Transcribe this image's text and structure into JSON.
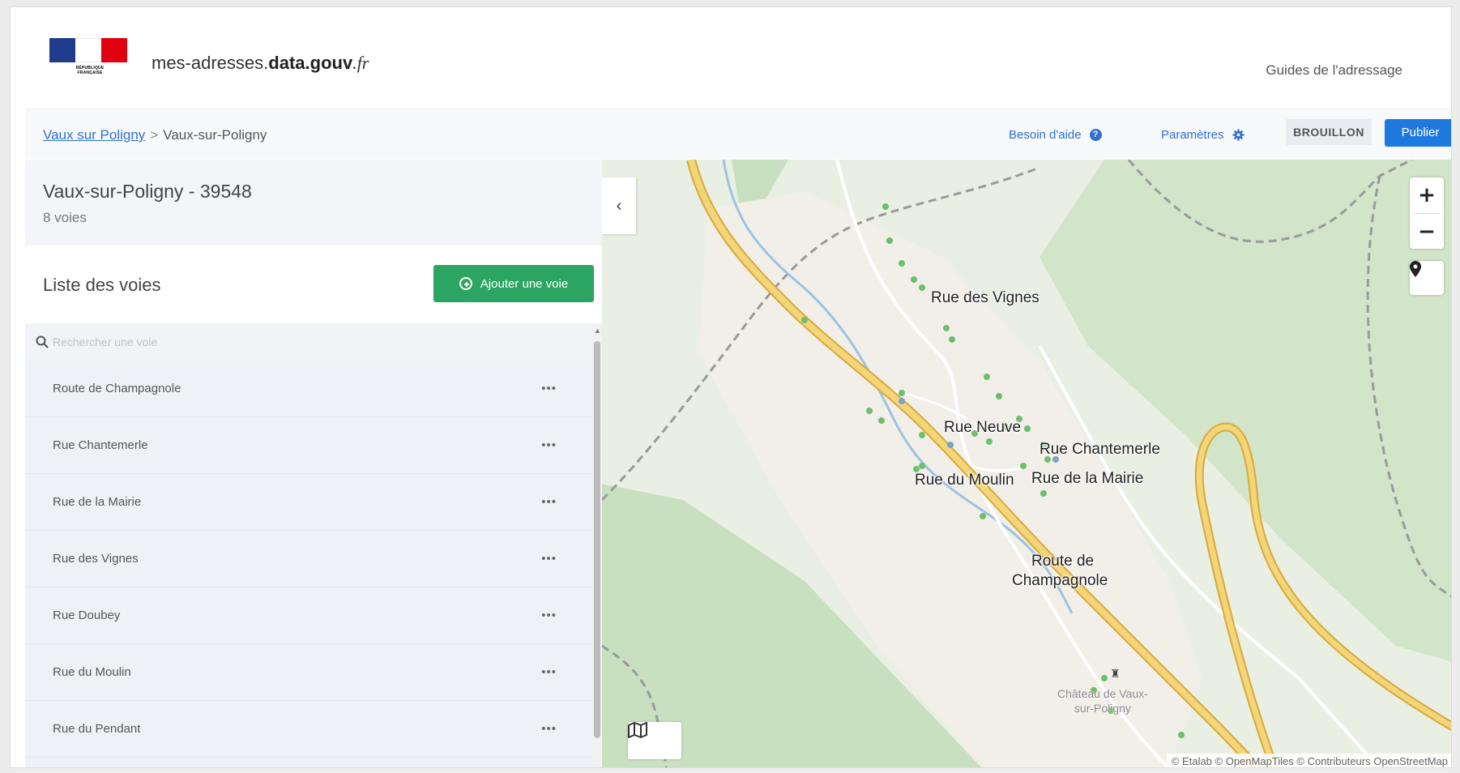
{
  "header": {
    "logo_text": "Liberté · Égalité · Fraternité\nRÉPUBLIQUE FRANÇAISE",
    "site_prefix": "mes-adresses.",
    "site_bold": "data.gouv",
    "site_suffix": ".fr",
    "guides_label": "Guides de l'adressage"
  },
  "toolbar": {
    "breadcrumb_link": "Vaux sur Poligny",
    "breadcrumb_sep": ">",
    "breadcrumb_current": "Vaux-sur-Poligny",
    "help_label": "Besoin d'aide",
    "settings_label": "Paramètres",
    "status_badge": "BROUILLON",
    "publish_label": "Publier"
  },
  "sidebar": {
    "commune_name": "Vaux-sur-Poligny - 39548",
    "voies_count": "8 voies",
    "list_title": "Liste des voies",
    "add_label": "Ajouter une voie",
    "search_placeholder": "Rechercher une voie",
    "voies": [
      {
        "name": "Route de Champagnole"
      },
      {
        "name": "Rue Chantemerle"
      },
      {
        "name": "Rue de la Mairie"
      },
      {
        "name": "Rue des Vignes"
      },
      {
        "name": "Rue Doubey"
      },
      {
        "name": "Rue du Moulin"
      },
      {
        "name": "Rue du Pendant"
      }
    ],
    "more_glyph": "•••"
  },
  "map": {
    "collapse_glyph": "‹",
    "zoom_in": "+",
    "zoom_out": "−",
    "labels": {
      "rue_des_vignes": "Rue des Vignes",
      "rue_neuve": "Rue Neuve",
      "rue_chantemerle": "Rue Chantemerle",
      "rue_du_moulin": "Rue du Moulin",
      "rue_de_la_mairie": "Rue de la Mairie",
      "route_line1": "Route de",
      "route_line2": "Champagnole",
      "chateau_line1": "Château de Vaux-",
      "chateau_line2": "sur-Poligny"
    },
    "poi_glyph": "♜",
    "attribution": "© Etalab © OpenMapTiles © Contributeurs OpenStreetMap",
    "colors": {
      "background": "#e9efe3",
      "forest": "#c9e0c0",
      "village": "#f2efe9",
      "main_road": "#f3d57a",
      "road_edge": "#d9a93a",
      "boundary": "#9a9a9a",
      "river": "#9cc3e0",
      "address_dot": "#6cbf6c"
    }
  },
  "colors": {
    "primary": "#1f7ae0",
    "success": "#2da562",
    "link": "#2e6fd6"
  }
}
